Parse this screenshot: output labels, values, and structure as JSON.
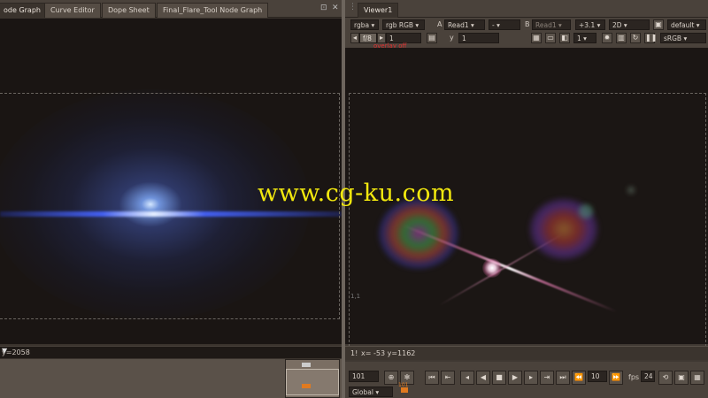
{
  "left_panel": {
    "tabs": [
      {
        "label": "ode Graph",
        "active": true
      },
      {
        "label": "Curve Editor",
        "active": false
      },
      {
        "label": "Dope Sheet",
        "active": false
      },
      {
        "label": "Final_Flare_Tool Node Graph",
        "active": false
      }
    ],
    "tab_controls": {
      "float_glyph": "⊡",
      "close_glyph": "✕"
    },
    "status_text": "y=2058",
    "status_dropdown_glyph": "▼"
  },
  "right_panel": {
    "tab_label": "Viewer1",
    "toolbar": {
      "channels": "rgba",
      "channels_rgb": "rgb RGB",
      "input_a_label": "A",
      "input_a": "Read1",
      "compare": "-",
      "input_b_label": "B",
      "input_b": "Read1",
      "gain": "+3.1",
      "view_mode": "2D",
      "lut": "default",
      "fstop": "f/8",
      "frame_value": "1",
      "y_label": "y",
      "y_value": "1",
      "proxy_value": "1",
      "colorspace": "sRGB"
    },
    "overlay_label": "overlay off",
    "frame_corner": "1,1",
    "status_coords_prefix": "1!",
    "status_coords": "x= -53 y=1162",
    "timeline": {
      "current_frame": "101",
      "increment": "10",
      "fps_label": "fps",
      "fps_value": "24",
      "playback_mode": "Global",
      "frame_tick": "101"
    }
  },
  "watermark": "www.cg-ku.com"
}
